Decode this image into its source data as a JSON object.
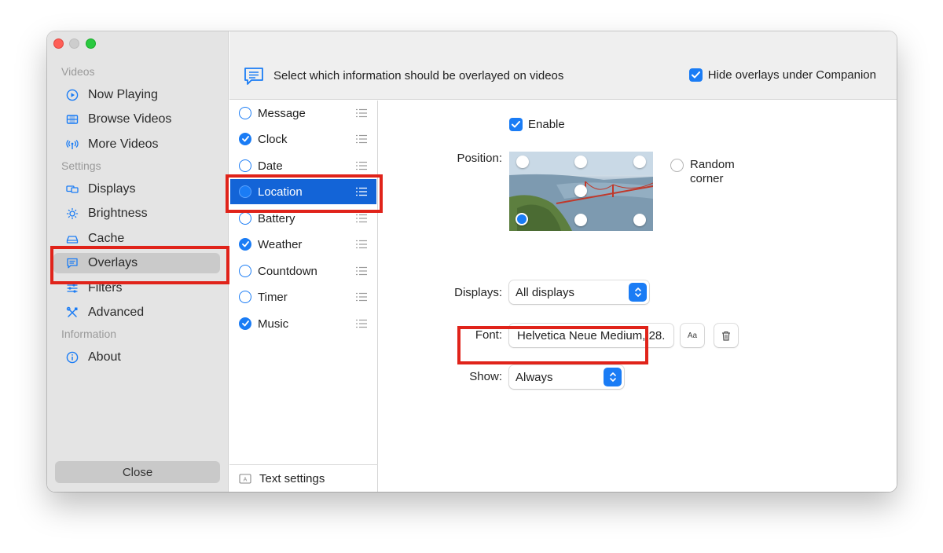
{
  "sidebar": {
    "sections": {
      "videos": "Videos",
      "settings": "Settings",
      "information": "Information"
    },
    "items": [
      {
        "label": "Now Playing",
        "icon": "play-circle-icon"
      },
      {
        "label": "Browse Videos",
        "icon": "film-icon"
      },
      {
        "label": "More Videos",
        "icon": "antenna-icon"
      },
      {
        "label": "Displays",
        "icon": "displays-icon"
      },
      {
        "label": "Brightness",
        "icon": "sun-icon"
      },
      {
        "label": "Cache",
        "icon": "drive-icon"
      },
      {
        "label": "Overlays",
        "icon": "message-icon",
        "selected": true
      },
      {
        "label": "Filters",
        "icon": "sliders-icon"
      },
      {
        "label": "Advanced",
        "icon": "tools-icon"
      },
      {
        "label": "About",
        "icon": "info-icon"
      }
    ],
    "close_label": "Close"
  },
  "topbar": {
    "title": "Select which information should be overlayed on videos",
    "hide_overlays_label": "Hide overlays under Companion",
    "hide_overlays_checked": true
  },
  "overlay_list": {
    "items": [
      {
        "label": "Message",
        "checked": false
      },
      {
        "label": "Clock",
        "checked": true
      },
      {
        "label": "Date",
        "checked": false
      },
      {
        "label": "Location",
        "checked": true,
        "selected": true
      },
      {
        "label": "Battery",
        "checked": false
      },
      {
        "label": "Weather",
        "checked": true
      },
      {
        "label": "Countdown",
        "checked": false
      },
      {
        "label": "Timer",
        "checked": false
      },
      {
        "label": "Music",
        "checked": true
      }
    ],
    "text_settings_label": "Text settings"
  },
  "detail": {
    "enable_label": "Enable",
    "enable_checked": true,
    "position_label": "Position:",
    "random_corner_label_line1": "Random",
    "random_corner_label_line2": "corner",
    "displays_label": "Displays:",
    "displays_value": "All displays",
    "font_label": "Font:",
    "font_value": "Helvetica Neue Medium, 28.",
    "font_button_label": "Aa",
    "show_label": "Show:",
    "show_value": "Always"
  },
  "colors": {
    "accent": "#1a7cf5",
    "selection": "#1364d7",
    "highlight_box": "#e0231a"
  }
}
